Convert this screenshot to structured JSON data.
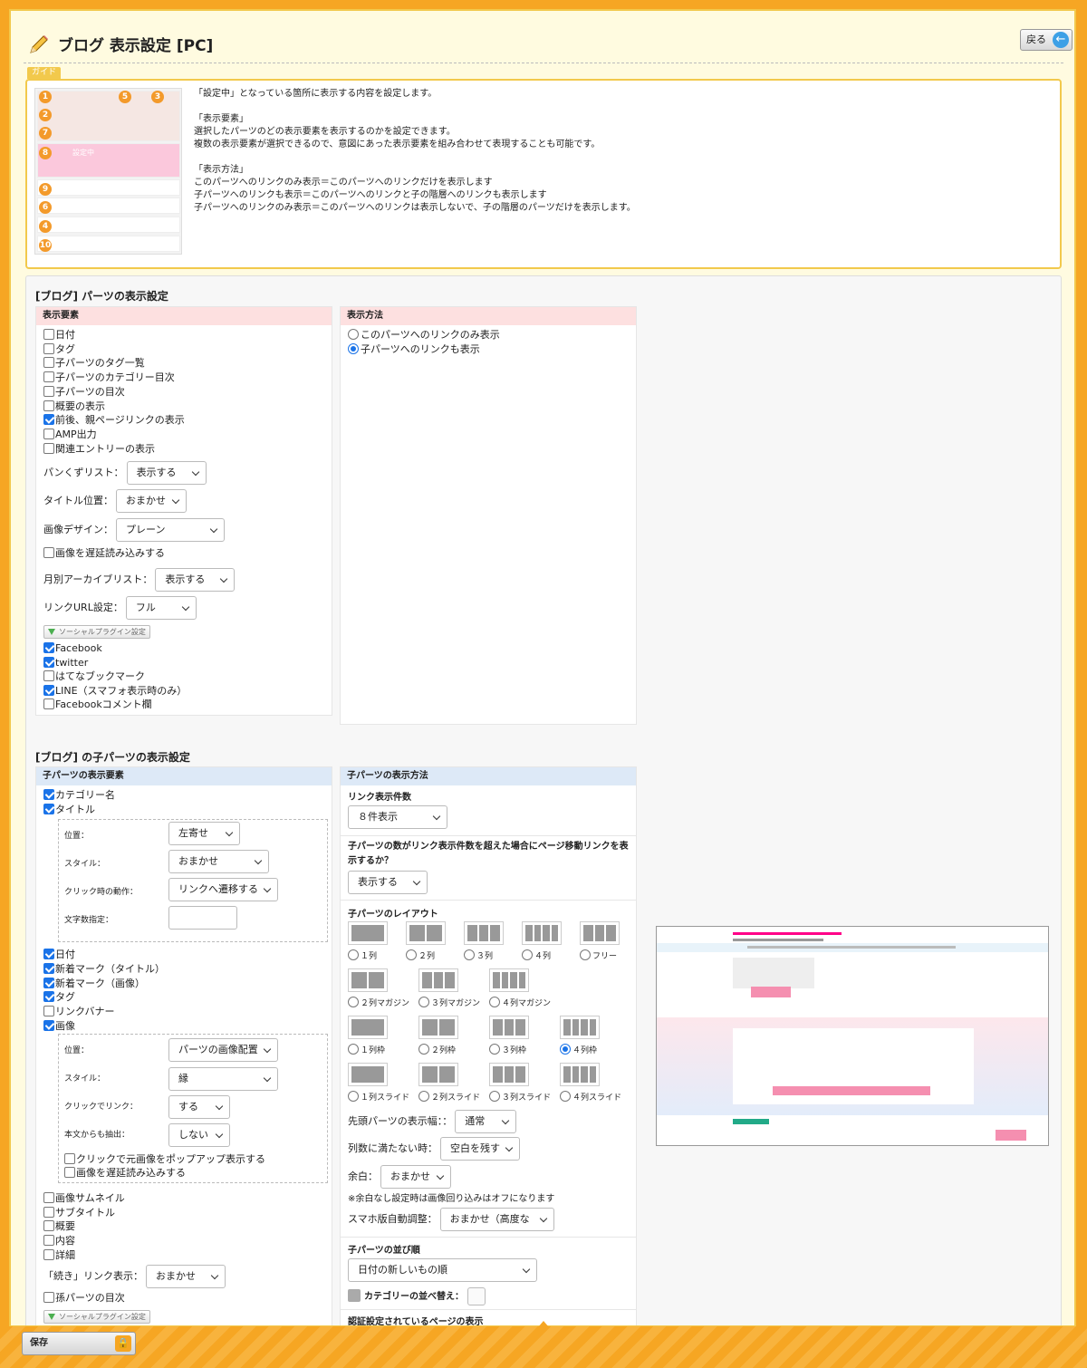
{
  "page": {
    "title": "ブログ 表示設定 [PC]",
    "back_label": "戻る",
    "save_label": "保存"
  },
  "guide": {
    "tab": "ガイド",
    "thumb_label": "設定中",
    "text": "「設定中」となっている箇所に表示する内容を設定します。\n\n「表示要素」\n選択したパーツのどの表示要素を表示するのかを設定できます。\n複数の表示要素が選択できるので、意図にあった表示要素を組み合わせて表現することも可能です。\n\n「表示方法」\nこのパーツへのリンクのみ表示＝このパーツへのリンクだけを表示します\n子パーツへのリンクも表示＝このパーツへのリンクと子の階層へのリンクも表示します\n子パーツへのリンクのみ表示＝このパーツへのリンクは表示しないで、子の階層のパーツだけを表示します。"
  },
  "parts": {
    "section_title": "[ブログ] パーツの表示設定",
    "elements_head": "表示要素",
    "method_head": "表示方法",
    "checks": [
      {
        "label": "日付",
        "checked": false
      },
      {
        "label": "タグ",
        "checked": false
      },
      {
        "label": "子パーツのタグ一覧",
        "checked": false
      },
      {
        "label": "子パーツのカテゴリー目次",
        "checked": false
      },
      {
        "label": "子パーツの目次",
        "checked": false
      },
      {
        "label": "概要の表示",
        "checked": false
      },
      {
        "label": "前後、親ページリンクの表示",
        "checked": true
      },
      {
        "label": "AMP出力",
        "checked": false
      },
      {
        "label": "関連エントリーの表示",
        "checked": false
      }
    ],
    "breadcrumb": {
      "label": "パンくずリスト：",
      "value": "表示する"
    },
    "title_pos": {
      "label": "タイトル位置：",
      "value": "おまかせ"
    },
    "image_design": {
      "label": "画像デザイン：",
      "value": "プレーン"
    },
    "lazy": {
      "label": "画像を遅延読み込みする",
      "checked": false
    },
    "monthly": {
      "label": "月別アーカイブリスト：",
      "value": "表示する"
    },
    "link_url": {
      "label": "リンクURL設定：",
      "value": "フル"
    },
    "social_btn": "ソーシャルプラグイン設定",
    "social": [
      {
        "label": "Facebook",
        "checked": true
      },
      {
        "label": "twitter",
        "checked": true
      },
      {
        "label": "はてなブックマーク",
        "checked": false
      },
      {
        "label": "LINE（スマフォ表示時のみ）",
        "checked": true
      },
      {
        "label": "Facebookコメント欄",
        "checked": false
      }
    ],
    "methods": [
      {
        "label": "このパーツへのリンクのみ表示",
        "selected": false
      },
      {
        "label": "子パーツへのリンクも表示",
        "selected": true
      }
    ]
  },
  "child": {
    "section_title": "[ブログ] の子パーツの表示設定",
    "elements_head": "子パーツの表示要素",
    "method_head": "子パーツの表示方法",
    "cat_name": {
      "label": "カテゴリー名",
      "checked": true
    },
    "title": {
      "label": "タイトル",
      "checked": true
    },
    "title_opts": [
      {
        "label": "位置：",
        "value": "左寄せ"
      },
      {
        "label": "スタイル：",
        "value": "おまかせ"
      },
      {
        "label": "クリック時の動作：",
        "value": "リンクへ遷移する"
      },
      {
        "label": "文字数指定：",
        "value": ""
      }
    ],
    "checks2": [
      {
        "label": "日付",
        "checked": true
      },
      {
        "label": "新着マーク（タイトル）",
        "checked": true
      },
      {
        "label": "新着マーク（画像）",
        "checked": true
      },
      {
        "label": "タグ",
        "checked": true
      },
      {
        "label": "リンクバナー",
        "checked": false
      },
      {
        "label": "画像",
        "checked": true
      }
    ],
    "image_opts": [
      {
        "label": "位置：",
        "value": "パーツの画像配置"
      },
      {
        "label": "スタイル：",
        "value": "縁"
      },
      {
        "label": "クリックでリンク：",
        "value": "する"
      },
      {
        "label": "本文からも抽出：",
        "value": "しない"
      }
    ],
    "image_checks": [
      {
        "label": "クリックで元画像をポップアップ表示する",
        "checked": false
      },
      {
        "label": "画像を遅延読み込みする",
        "checked": false
      }
    ],
    "checks3": [
      {
        "label": "画像サムネイル",
        "checked": false
      },
      {
        "label": "サブタイトル",
        "checked": false
      },
      {
        "label": "概要",
        "checked": false
      },
      {
        "label": "内容",
        "checked": false
      },
      {
        "label": "詳細",
        "checked": false
      }
    ],
    "continue": {
      "label": "「続き」リンク表示：",
      "value": "おまかせ"
    },
    "grandchild": {
      "label": "孫パーツの目次",
      "checked": false
    },
    "social_btn": "ソーシャルプラグイン設定",
    "link_count_head": "リンク表示件数",
    "link_count": "８件表示",
    "paging_head": "子パーツの数がリンク表示件数を超えた場合にページ移動リンクを表示するか？",
    "paging": "表示する",
    "layout_head": "子パーツのレイアウト",
    "layouts": [
      [
        {
          "label": "１列",
          "cols": 1,
          "selected": false
        },
        {
          "label": "２列",
          "cols": 2,
          "selected": false
        },
        {
          "label": "３列",
          "cols": 3,
          "selected": false
        },
        {
          "label": "４列",
          "cols": 4,
          "selected": false
        },
        {
          "label": "フリー",
          "cols": 3,
          "selected": false
        }
      ],
      [
        {
          "label": "２列マガジン",
          "cols": 2,
          "selected": false
        },
        {
          "label": "３列マガジン",
          "cols": 3,
          "selected": false
        },
        {
          "label": "４列マガジン",
          "cols": 4,
          "selected": false
        }
      ],
      [
        {
          "label": "１列枠",
          "cols": 1,
          "selected": false
        },
        {
          "label": "２列枠",
          "cols": 2,
          "selected": false
        },
        {
          "label": "３列枠",
          "cols": 3,
          "selected": false
        },
        {
          "label": "４列枠",
          "cols": 4,
          "selected": true
        }
      ],
      [
        {
          "label": "１列スライド",
          "cols": 1,
          "selected": false
        },
        {
          "label": "２列スライド",
          "cols": 2,
          "selected": false
        },
        {
          "label": "３列スライド",
          "cols": 3,
          "selected": false
        },
        {
          "label": "４列スライド",
          "cols": 4,
          "selected": false
        }
      ]
    ],
    "first_width": {
      "label": "先頭パーツの表示幅：：",
      "value": "通常"
    },
    "short_cols": {
      "label": "列数に満たない時：",
      "value": "空白を残す"
    },
    "margin": {
      "label": "余白：",
      "value": "おまかせ"
    },
    "margin_note": "※余白なし設定時は画像回り込みはオフになります",
    "sp_adjust": {
      "label": "スマホ版自動調整：",
      "value": "おまかせ（高度な"
    },
    "order_head": "子パーツの並び順",
    "order": "日付の新しいもの順",
    "cat_sort": "カテゴリーの並べ替え：",
    "auth_head": "認証設定されているページの表示"
  },
  "colors": {
    "accent": "#f6a623",
    "pink": "#fde0e0",
    "blue": "#dde9f7",
    "check": "#1a73e8"
  }
}
